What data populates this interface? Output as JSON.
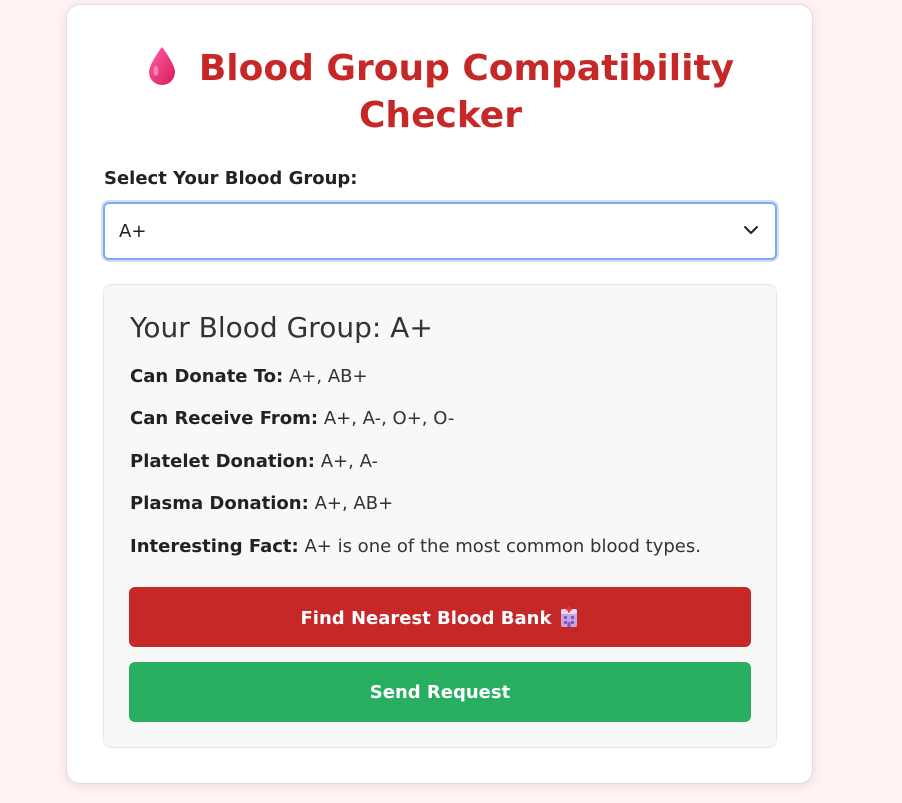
{
  "header": {
    "title": "Blood Group Compatibility Checker",
    "icon": "blood-drop-icon"
  },
  "selector": {
    "label": "Select Your Blood Group:",
    "selected": "A+"
  },
  "result": {
    "heading": "Your Blood Group: A+",
    "rows": [
      {
        "key": "Can Donate To:",
        "value": "A+, AB+"
      },
      {
        "key": "Can Receive From:",
        "value": "A+, A-, O+, O-"
      },
      {
        "key": "Platelet Donation:",
        "value": "A+, A-"
      },
      {
        "key": "Plasma Donation:",
        "value": "A+, AB+"
      },
      {
        "key": "Interesting Fact:",
        "value": "A+ is one of the most common blood types."
      }
    ]
  },
  "buttons": {
    "find_bank": "Find Nearest Blood Bank",
    "find_bank_icon": "hospital-icon",
    "send_request": "Send Request"
  },
  "colors": {
    "accent_red": "#c62828",
    "accent_green": "#27ae60",
    "page_bg": "#fff4f3",
    "focus_blue": "#7aaaf2"
  }
}
